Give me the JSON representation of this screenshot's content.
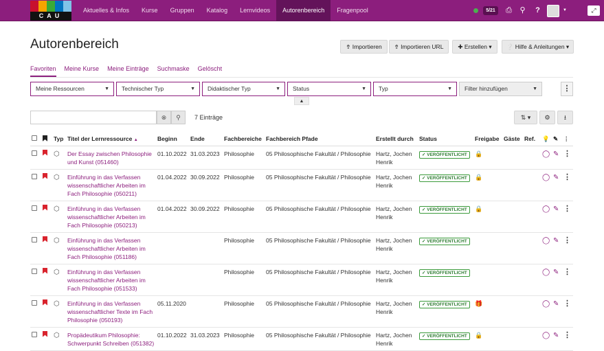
{
  "logo_text": "CAU",
  "nav": [
    "Aktuelles & Infos",
    "Kurse",
    "Gruppen",
    "Katalog",
    "Lernvideos",
    "Autorenbereich",
    "Fragenpool"
  ],
  "nav_active": 5,
  "notifications": "5/21",
  "icons": {
    "print": "print-icon",
    "search": "search-icon",
    "help": "help-icon",
    "fullscreen": "fullscreen-icon"
  },
  "page_title": "Autorenbereich",
  "actions": {
    "import": "Importieren",
    "import_url": "Importieren URL",
    "create": "Erstellen",
    "help": "Hilfe & Anleitungen"
  },
  "tabs": [
    "Favoriten",
    "Meine Kurse",
    "Meine Einträge",
    "Suchmaske",
    "Gelöscht"
  ],
  "filters": [
    "Meine Ressourcen",
    "Technischer Typ",
    "Didaktischer Typ",
    "Status",
    "Typ"
  ],
  "filter_add": "Filter hinzufügen",
  "search": {
    "value": "",
    "placeholder": ""
  },
  "count": "7 Einträge",
  "columns": [
    "Typ",
    "Titel der Lernressource",
    "Beginn",
    "Ende",
    "Fachbereiche",
    "Fachbereich Pfade",
    "Erstellt durch",
    "Status",
    "Freigabe",
    "Gäste",
    "Ref."
  ],
  "rows": [
    {
      "title": "Der Essay zwischen Philosophie und Kunst (051460)",
      "begin": "01.10.2022",
      "end": "31.03.2023",
      "field": "Philosophie",
      "path": "05 Philosophische Fakultät / Philosophie",
      "author": "Hartz, Jochen Henrik",
      "status": "VERÖFFENTLICHT",
      "share": "lock"
    },
    {
      "title": "Einführung in das Verfassen wissenschaftlicher Arbeiten im Fach Philosophie (050211)",
      "begin": "01.04.2022",
      "end": "30.09.2022",
      "field": "Philosophie",
      "path": "05 Philosophische Fakultät / Philosophie",
      "author": "Hartz, Jochen Henrik",
      "status": "VERÖFFENTLICHT",
      "share": "lock"
    },
    {
      "title": "Einführung in das Verfassen wissenschaftlicher Arbeiten im Fach Philosophie (050213)",
      "begin": "01.04.2022",
      "end": "30.09.2022",
      "field": "Philosophie",
      "path": "05 Philosophische Fakultät / Philosophie",
      "author": "Hartz, Jochen Henrik",
      "status": "VERÖFFENTLICHT",
      "share": "lock"
    },
    {
      "title": "Einführung in das Verfassen wissenschaftlicher Arbeiten im Fach Philosophie (051186)",
      "begin": "",
      "end": "",
      "field": "Philosophie",
      "path": "05 Philosophische Fakultät / Philosophie",
      "author": "Hartz, Jochen Henrik",
      "status": "VERÖFFENTLICHT",
      "share": ""
    },
    {
      "title": "Einführung in das Verfassen wissenschaftlicher Arbeiten im Fach Philosophie (051533)",
      "begin": "",
      "end": "",
      "field": "Philosophie",
      "path": "05 Philosophische Fakultät / Philosophie",
      "author": "Hartz, Jochen Henrik",
      "status": "VERÖFFENTLICHT",
      "share": ""
    },
    {
      "title": "Einführung in das Verfassen wissenschaftlicher Texte im Fach Philosophie (050193)",
      "begin": "05.11.2020",
      "end": "",
      "field": "Philosophie",
      "path": "05 Philosophische Fakultät / Philosophie",
      "author": "Hartz, Jochen Henrik",
      "status": "VERÖFFENTLICHT",
      "share": "gift"
    },
    {
      "title": "Propädeutikum Philosophie: Schwerpunkt Schreiben (051382)",
      "begin": "01.10.2022",
      "end": "31.03.2023",
      "field": "Philosophie",
      "path": "05 Philosophische Fakultät / Philosophie",
      "author": "Hartz, Jochen Henrik",
      "status": "VERÖFFENTLICHT",
      "share": "lock"
    }
  ]
}
